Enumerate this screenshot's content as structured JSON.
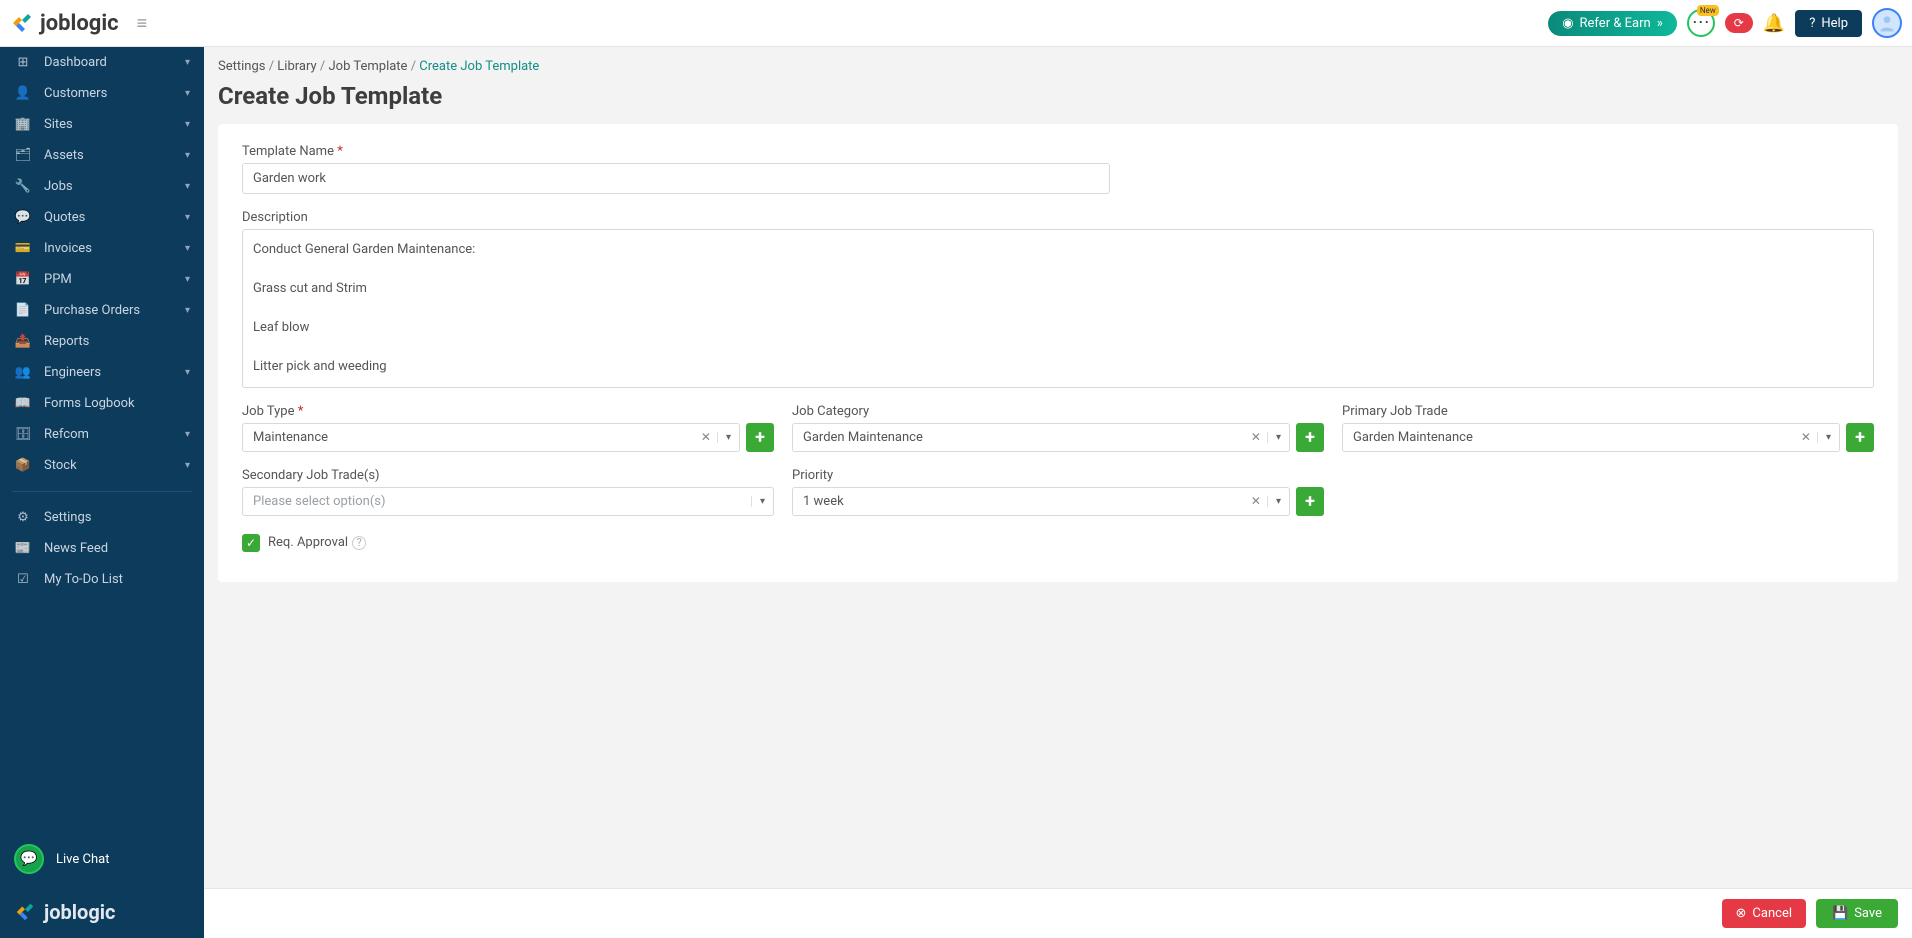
{
  "header": {
    "brand": "joblogic",
    "refer_label": "Refer & Earn",
    "new_tag": "New",
    "help_label": "Help"
  },
  "sidebar": {
    "items": [
      {
        "label": "Dashboard",
        "icon": "📊",
        "expand": true
      },
      {
        "label": "Customers",
        "icon": "👤",
        "expand": true
      },
      {
        "label": "Sites",
        "icon": "🏢",
        "expand": true
      },
      {
        "label": "Assets",
        "icon": "🗂",
        "expand": true
      },
      {
        "label": "Jobs",
        "icon": "🔧",
        "expand": true
      },
      {
        "label": "Quotes",
        "icon": "💬",
        "expand": true
      },
      {
        "label": "Invoices",
        "icon": "💳",
        "expand": true
      },
      {
        "label": "PPM",
        "icon": "📅",
        "expand": true
      },
      {
        "label": "Purchase Orders",
        "icon": "📄",
        "expand": true
      },
      {
        "label": "Reports",
        "icon": "📤",
        "expand": false
      },
      {
        "label": "Engineers",
        "icon": "👥",
        "expand": true
      },
      {
        "label": "Forms Logbook",
        "icon": "📖",
        "expand": false
      },
      {
        "label": "Refcom",
        "icon": "🗄",
        "expand": true
      },
      {
        "label": "Stock",
        "icon": "📦",
        "expand": true
      }
    ],
    "bottom": [
      {
        "label": "Settings",
        "icon": "⚙"
      },
      {
        "label": "News Feed",
        "icon": "📰"
      },
      {
        "label": "My To-Do List",
        "icon": "☑"
      }
    ],
    "live_chat": "Live Chat",
    "footer_brand": "joblogic"
  },
  "breadcrumb": {
    "settings": "Settings",
    "library": "Library",
    "job_template": "Job Template",
    "current": "Create Job Template"
  },
  "page": {
    "title": "Create Job Template"
  },
  "form": {
    "template_name_label": "Template Name",
    "template_name_value": "Garden work",
    "description_label": "Description",
    "description_value": "Conduct General Garden Maintenance:\n\nGrass cut and Strim\n\nLeaf blow\n\nLitter pick and weeding",
    "job_type_label": "Job Type",
    "job_type_value": "Maintenance",
    "job_category_label": "Job Category",
    "job_category_value": "Garden Maintenance",
    "primary_trade_label": "Primary Job Trade",
    "primary_trade_value": "Garden Maintenance",
    "secondary_trade_label": "Secondary Job Trade(s)",
    "secondary_trade_placeholder": "Please select option(s)",
    "priority_label": "Priority",
    "priority_value": "1 week",
    "req_approval_label": "Req. Approval"
  },
  "footer": {
    "cancel": "Cancel",
    "save": "Save"
  }
}
